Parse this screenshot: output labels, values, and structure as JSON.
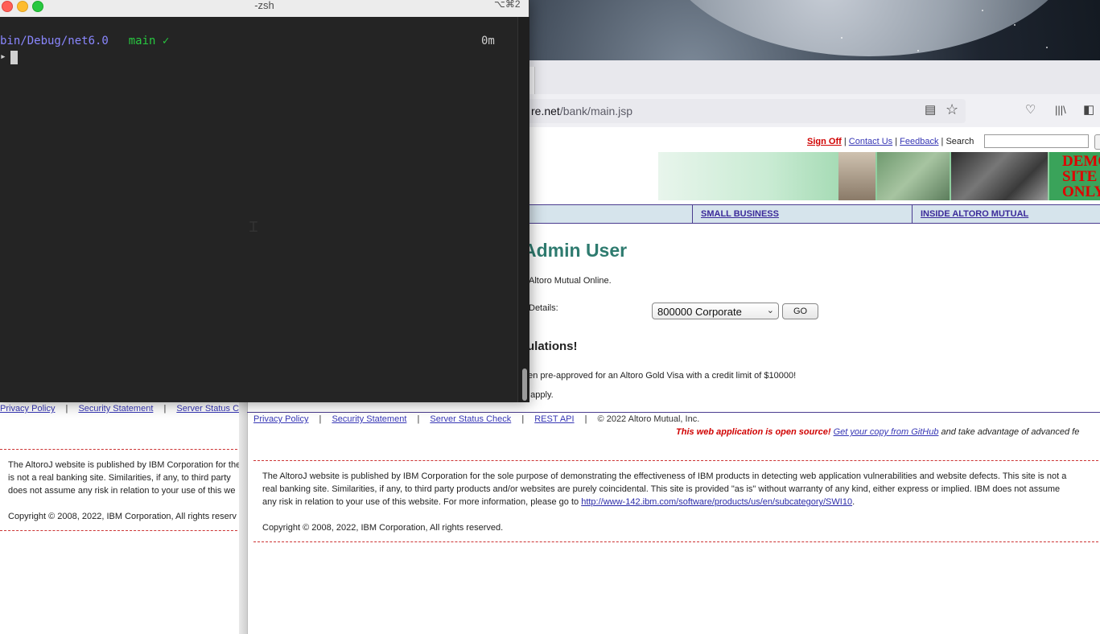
{
  "terminal": {
    "title": "-zsh",
    "shortcut": "⌥⌘2",
    "path": "bin/Debug/net6.0",
    "branch": "main ✓",
    "elapsed": "0m",
    "prompt_symbol": "▸"
  },
  "browser": {
    "url_host": "re.net",
    "url_path": "/bank/main.jsp"
  },
  "top_nav": {
    "sign_off": "Sign Off",
    "contact_us": "Contact Us",
    "feedback": "Feedback",
    "search_label": "Search",
    "search_value": ""
  },
  "banner": {
    "demo_line1": "DEMO",
    "demo_line2": "SITE",
    "demo_line3": "ONLY"
  },
  "nav_tabs": {
    "small_business": "SMALL BUSINESS",
    "inside": "INSIDE ALTORO MUTUAL"
  },
  "main": {
    "title": "Admin User",
    "welcome": "Altoro Mutual Online.",
    "account_label": "Details:",
    "account_selected": "800000 Corporate",
    "go_label": "GO",
    "congrats": "tulations!",
    "preapproved": "een pre-approved for an Altoro Gold Visa with a credit limit of $10000!",
    "apply": "o apply."
  },
  "footer": {
    "privacy": "Privacy Policy",
    "security": "Security Statement",
    "server_status": "Server Status Check",
    "rest_api": "REST API",
    "copyright_inline": "© 2022 Altoro Mutual, Inc.",
    "opensource_red": "This web application is open source!",
    "opensource_link": "Get your copy from GitHub",
    "opensource_tail": "and take advantage of advanced fe",
    "disclaimer_1": "The AltoroJ website is published by IBM Corporation for the sole purpose of demonstrating the effectiveness of IBM products in detecting web application vulnerabilities and website defects. This site is not a",
    "disclaimer_2": "real banking site. Similarities, if any, to third party products and/or websites are purely coincidental. This site is provided \"as is\" without warranty of any kind, either express or implied. IBM does not assume",
    "disclaimer_3": "any risk in relation to your use of this website. For more information, please go to",
    "disclaimer_link": "http://www-142.ibm.com/software/products/us/en/subcategory/SWI10",
    "copyright": "Copyright © 2008, 2022, IBM Corporation, All rights reserved."
  },
  "bg_window": {
    "privacy": "Privacy Policy",
    "security": "Security Statement",
    "server_status": "Server Status Che",
    "disclaimer_1": "The AltoroJ website is published by IBM Corporation for the",
    "disclaimer_2": "is not a real banking site. Similarities, if any, to third party",
    "disclaimer_3": "does not assume any risk in relation to your use of this we",
    "copyright": "Copyright © 2008, 2022, IBM Corporation, All rights reserv"
  }
}
